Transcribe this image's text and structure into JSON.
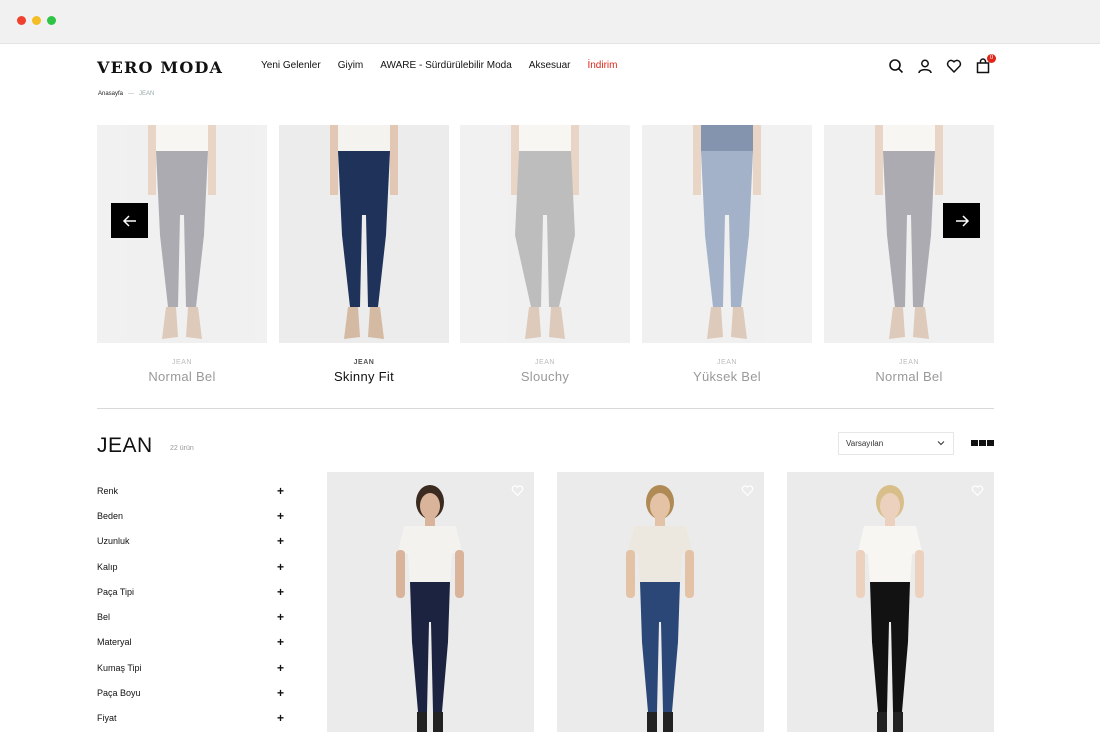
{
  "brand": {
    "logo": "VERO MODA"
  },
  "nav": {
    "items": [
      "Yeni Gelenler",
      "Giyim",
      "AWARE - Sürdürülebilir Moda",
      "Aksesuar"
    ],
    "sale": "İndirim"
  },
  "header_icons": [
    "search-icon",
    "user-icon",
    "heart-icon",
    "bag-icon"
  ],
  "cart": {
    "count": "0"
  },
  "breadcrumb": {
    "home": "Anasayfa",
    "separator": "—",
    "current": "JEAN"
  },
  "fits": [
    {
      "category": "JEAN",
      "name": "Normal Bel",
      "active": false,
      "pants": "#8f8f98",
      "top": "#f5f3ef"
    },
    {
      "category": "JEAN",
      "name": "Skinny Fit",
      "active": true,
      "pants": "#1f3259",
      "top": "#f5f3ef"
    },
    {
      "category": "JEAN",
      "name": "Slouchy",
      "active": false,
      "pants": "#a8a8a8",
      "top": "#f5f3ef"
    },
    {
      "category": "JEAN",
      "name": "Yüksek Bel",
      "active": false,
      "pants": "#8599b8",
      "top": "#5c6f94"
    },
    {
      "category": "JEAN",
      "name": "Normal Bel",
      "active": false,
      "pants": "#8f8f98",
      "top": "#f5f3ef"
    }
  ],
  "listing": {
    "title": "JEAN",
    "count": "22 ürün"
  },
  "sort": {
    "selected": "Varsayılan"
  },
  "filters": [
    "Renk",
    "Beden",
    "Uzunluk",
    "Kalıp",
    "Paça Tipi",
    "Bel",
    "Materyal",
    "Kumaş Tipi",
    "Paça Boyu",
    "Fiyat"
  ],
  "products": [
    {
      "hair": "#3a2a1f",
      "top": "#f4f2ee",
      "pants": "#1c2340",
      "skin": "#d9b49a"
    },
    {
      "hair": "#b08a55",
      "top": "#ece8df",
      "pants": "#2a4778",
      "skin": "#e3c2a6"
    },
    {
      "hair": "#d8bf8a",
      "top": "#f7f6f3",
      "pants": "#121212",
      "skin": "#ecd2be"
    }
  ]
}
